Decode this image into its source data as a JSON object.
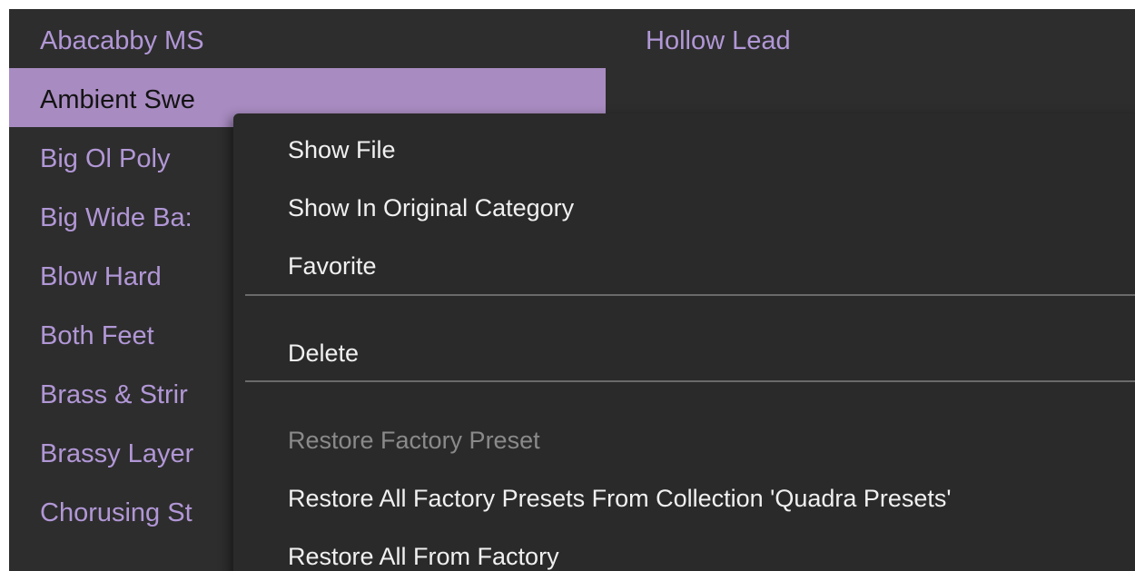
{
  "left_list": {
    "items": [
      {
        "label": "Abacabby MS"
      },
      {
        "label": "Ambient Swe"
      },
      {
        "label": "Big Ol Poly"
      },
      {
        "label": "Big Wide Ba:"
      },
      {
        "label": "Blow Hard"
      },
      {
        "label": "Both Feet"
      },
      {
        "label": "Brass & Strir"
      },
      {
        "label": "Brassy Layer"
      },
      {
        "label": "Chorusing St"
      }
    ],
    "selected_index": 1
  },
  "right_list": {
    "items": [
      {
        "label": "Hollow Lead"
      }
    ]
  },
  "context_menu": {
    "items": [
      {
        "label": "Show File",
        "enabled": true
      },
      {
        "label": "Show In Original Category",
        "enabled": true
      },
      {
        "label": "Favorite",
        "enabled": true
      },
      {
        "label": "Delete",
        "enabled": true
      },
      {
        "label": "Restore Factory Preset",
        "enabled": false
      },
      {
        "label": "Restore All Factory Presets From Collection 'Quadra Presets'",
        "enabled": true
      },
      {
        "label": "Restore All From Factory",
        "enabled": true
      }
    ]
  },
  "colors": {
    "background": "#2d2d2d",
    "item_text": "#b197d6",
    "selected_bg": "#a88bc1",
    "menu_bg": "#2a2a2a",
    "menu_text": "#f0f0f0",
    "menu_disabled": "#8a8a8a"
  }
}
